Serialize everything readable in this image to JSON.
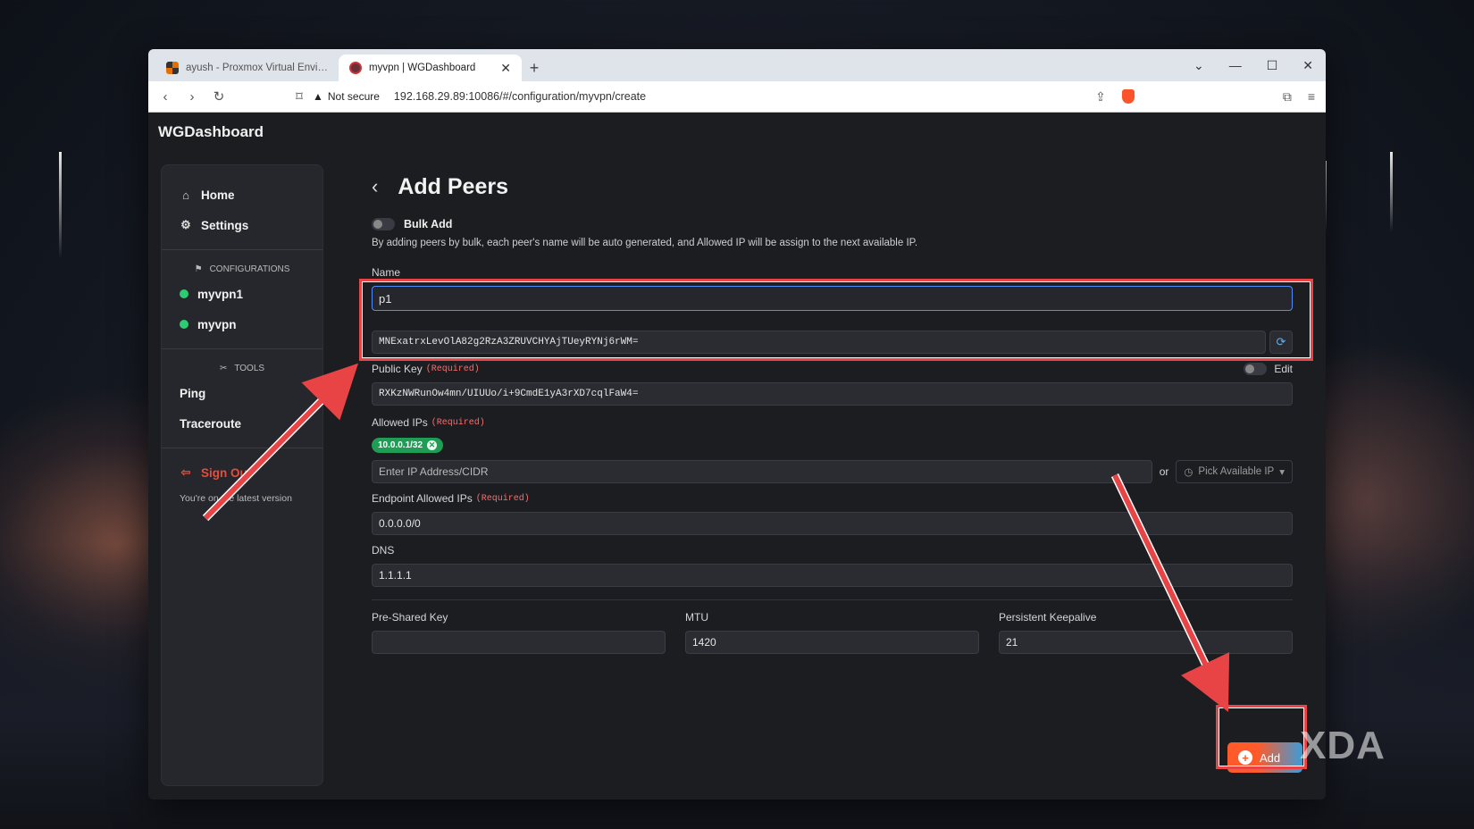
{
  "browser": {
    "tabs": [
      {
        "title": "ayush - Proxmox Virtual Environme",
        "active": false
      },
      {
        "title": "myvpn | WGDashboard",
        "active": true
      }
    ],
    "security": "Not secure",
    "url": "192.168.29.89:10086/#/configuration/myvpn/create"
  },
  "app": {
    "brand": "WGDashboard",
    "sidebar": {
      "nav": [
        {
          "label": "Home",
          "icon": "home-icon"
        },
        {
          "label": "Settings",
          "icon": "gear-icon"
        }
      ],
      "configurations_header": "CONFIGURATIONS",
      "configurations": [
        {
          "label": "myvpn1",
          "status": "#2ecc71"
        },
        {
          "label": "myvpn",
          "status": "#2ecc71"
        }
      ],
      "tools_header": "TOOLS",
      "tools": [
        "Ping",
        "Traceroute"
      ],
      "sign_out": "Sign Out",
      "version_note": "You're on the latest version"
    },
    "page": {
      "title": "Add Peers",
      "bulk_add_label": "Bulk Add",
      "bulk_add_enabled": false,
      "bulk_help": "By adding peers by bulk, each peer's name will be auto generated, and Allowed IP will be assign to the next available IP.",
      "name_label": "Name",
      "name_value": "p1",
      "private_key_value": "MNExatrxLevOlA82g2RzA3ZRUVCHYAjTUeyRYNj6rWM=",
      "public_key_label": "Public Key",
      "required": "(Required)",
      "edit_label": "Edit",
      "public_key_value": "RXKzNWRunOw4mn/UIUUo/i+9CmdE1yA3rXD7cqlFaW4=",
      "allowed_ips_label": "Allowed IPs",
      "allowed_ip_chip": "10.0.0.1/32",
      "ip_input_placeholder": "Enter IP Address/CIDR",
      "or_label": "or",
      "pick_ip_label": "Pick Available IP",
      "endpoint_label": "Endpoint Allowed IPs",
      "endpoint_value": "0.0.0.0/0",
      "dns_label": "DNS",
      "dns_value": "1.1.1.1",
      "psk_label": "Pre-Shared Key",
      "psk_value": "",
      "mtu_label": "MTU",
      "mtu_value": "1420",
      "keepalive_label": "Persistent Keepalive",
      "keepalive_value": "21",
      "add_button": "Add"
    }
  },
  "watermark": "XDA",
  "accent_colors": {
    "highlight": "#e84445",
    "online": "#2ecc71",
    "chip": "#1f9d55",
    "required": "#ff6b6b"
  }
}
